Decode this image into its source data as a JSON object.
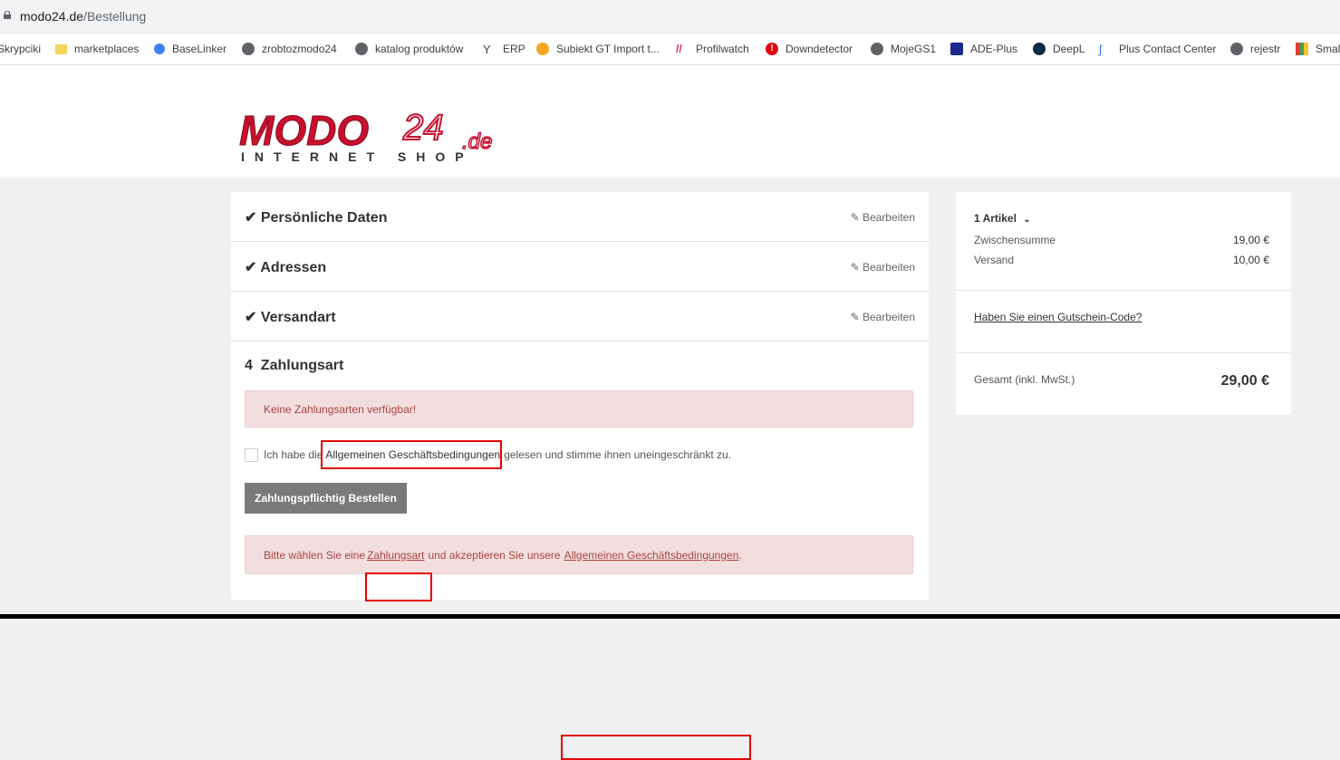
{
  "browser": {
    "url_host": "modo24.de",
    "url_path": "/Bestellung"
  },
  "bookmarks": [
    {
      "label": "Skrypciki",
      "icon": "none"
    },
    {
      "label": "marketplaces",
      "icon": "folder-icon"
    },
    {
      "label": "BaseLinker",
      "icon": "baselinker-icon"
    },
    {
      "label": "zrobtozmodo24",
      "icon": "globe-icon"
    },
    {
      "label": "katalog produktów",
      "icon": "globe-icon"
    },
    {
      "label": "ERP",
      "icon": "erp-icon"
    },
    {
      "label": "Subiekt GT Import t...",
      "icon": "subiekt-icon"
    },
    {
      "label": "Profilwatch",
      "icon": "profilwatch-icon"
    },
    {
      "label": "Downdetector",
      "icon": "alert-icon"
    },
    {
      "label": "MojeGS1",
      "icon": "globe-icon"
    },
    {
      "label": "ADE-Plus",
      "icon": "gls-icon"
    },
    {
      "label": "DeepL",
      "icon": "deepl-icon"
    },
    {
      "label": "Plus Contact Center",
      "icon": "plus-icon"
    },
    {
      "label": "rejestr",
      "icon": "globe-icon"
    },
    {
      "label": "Smal",
      "icon": "grid-icon"
    }
  ],
  "logo": {
    "main": "MODO",
    "num": "24",
    "tld": ".de",
    "tagline": "INTERNET SHOP"
  },
  "checkout": {
    "steps": [
      {
        "title": "Persönliche Daten",
        "edit": "Bearbeiten"
      },
      {
        "title": "Adressen",
        "edit": "Bearbeiten"
      },
      {
        "title": "Versandart",
        "edit": "Bearbeiten"
      }
    ],
    "payment": {
      "number": "4",
      "title": "Zahlungsart",
      "no_methods_alert": "Keine Zahlungsarten verfügbar!",
      "terms_prefix": "Ich habe die ",
      "terms_link": "Allgemeinen Geschäftsbedingungen",
      "terms_suffix": " gelesen und stimme ihnen uneingeschränkt zu.",
      "order_button": "Zahlungspflichtig Bestellen",
      "bottom_alert_prefix": "Bitte wählen Sie eine ",
      "bottom_alert_link1": "Zahlungsart",
      "bottom_alert_mid": " und akzeptieren Sie unsere ",
      "bottom_alert_link2": "Allgemeinen Geschäftsbedingungen",
      "bottom_alert_suffix": "."
    }
  },
  "summary": {
    "items_label": "1 Artikel",
    "subtotal_label": "Zwischensumme",
    "subtotal_value": "19,00 €",
    "shipping_label": "Versand",
    "shipping_value": "10,00 €",
    "coupon_link": "Haben Sie einen Gutschein-Code?",
    "total_label": "Gesamt (inkl. MwSt.)",
    "total_value": "29,00 €"
  },
  "colors": {
    "brand_red": "#c8102e",
    "alert_bg": "#f2dede",
    "alert_text": "#a94442",
    "highlight_box": "#e30000"
  }
}
